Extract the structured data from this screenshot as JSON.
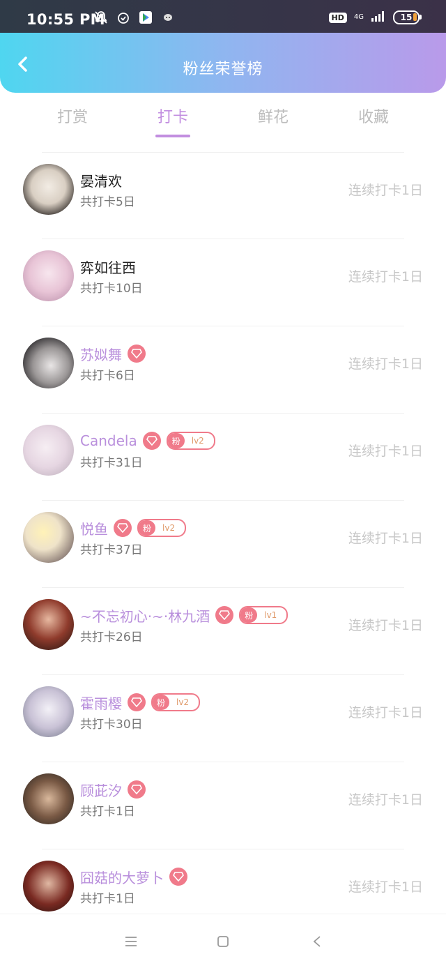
{
  "status": {
    "time": "10:55 PM",
    "hd": "HD",
    "network": "4G",
    "battery": "15"
  },
  "header": {
    "title": "粉丝荣誉榜"
  },
  "tabs": [
    {
      "label": "打赏"
    },
    {
      "label": "打卡"
    },
    {
      "label": "鲜花"
    },
    {
      "label": "收藏"
    }
  ],
  "active_tab": "打卡",
  "fans": [
    {
      "name": "晏清欢",
      "count": "共打卡5日",
      "streak": "连续打卡1日",
      "vip": false,
      "badge": false,
      "level": ""
    },
    {
      "name": "弈如往西",
      "count": "共打卡10日",
      "streak": "连续打卡1日",
      "vip": false,
      "badge": false,
      "level": ""
    },
    {
      "name": "苏姒舞",
      "count": "共打卡6日",
      "streak": "连续打卡1日",
      "vip": true,
      "badge": false,
      "level": ""
    },
    {
      "name": "Candela",
      "count": "共打卡31日",
      "streak": "连续打卡1日",
      "vip": true,
      "badge": true,
      "level": "lv2"
    },
    {
      "name": "悦鱼",
      "count": "共打卡37日",
      "streak": "连续打卡1日",
      "vip": true,
      "badge": true,
      "level": "lv2"
    },
    {
      "name": "~不忘初心·~·林九酒",
      "count": "共打卡26日",
      "streak": "连续打卡1日",
      "vip": true,
      "badge": true,
      "level": "lv1"
    },
    {
      "name": "霍雨樱",
      "count": "共打卡30日",
      "streak": "连续打卡1日",
      "vip": true,
      "badge": true,
      "level": "lv2"
    },
    {
      "name": "顾茈汐",
      "count": "共打卡1日",
      "streak": "连续打卡1日",
      "vip": true,
      "badge": false,
      "level": ""
    },
    {
      "name": "囧菇的大萝卜",
      "count": "共打卡1日",
      "streak": "连续打卡1日",
      "vip": true,
      "badge": false,
      "level": ""
    }
  ],
  "fan_badge_text": "粉",
  "colors": {
    "accent": "#c28ee0",
    "vip_name": "#b98fdc",
    "badge": "#f07a8a",
    "header_gradient": [
      "#4fd6f0",
      "#b99aea"
    ]
  },
  "icons": {
    "back": "chevron-left-icon",
    "diamond": "diamond-icon",
    "nav": [
      "menu-icon",
      "home-square-icon",
      "back-triangle-icon"
    ]
  }
}
